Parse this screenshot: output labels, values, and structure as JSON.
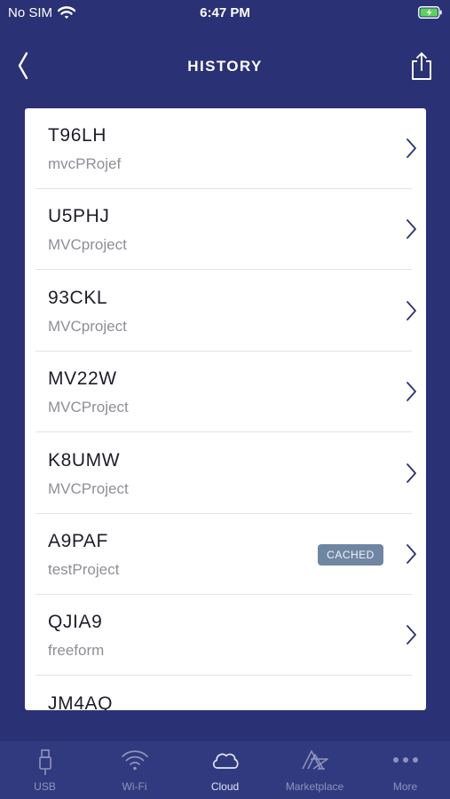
{
  "status_bar": {
    "carrier": "No SIM",
    "time": "6:47 PM"
  },
  "navbar": {
    "title": "HISTORY",
    "back_icon": "chevron-left-icon",
    "share_icon": "share-icon"
  },
  "history": {
    "items": [
      {
        "code": "T96LH",
        "project": "mvcPRojef",
        "badge": ""
      },
      {
        "code": "U5PHJ",
        "project": "MVCproject",
        "badge": ""
      },
      {
        "code": "93CKL",
        "project": "MVCproject",
        "badge": ""
      },
      {
        "code": "MV22W",
        "project": "MVCProject",
        "badge": ""
      },
      {
        "code": "K8UMW",
        "project": "MVCProject",
        "badge": ""
      },
      {
        "code": "A9PAF",
        "project": "testProject",
        "badge": "CACHED"
      },
      {
        "code": "QJIA9",
        "project": "freeform",
        "badge": ""
      },
      {
        "code": "JM4AQ",
        "project": "",
        "badge": ""
      }
    ]
  },
  "tabbar": {
    "tabs": [
      {
        "label": "USB",
        "icon": "usb-icon"
      },
      {
        "label": "Wi-Fi",
        "icon": "wifi-icon"
      },
      {
        "label": "Cloud",
        "icon": "cloud-icon"
      },
      {
        "label": "Marketplace",
        "icon": "marketplace-icon"
      },
      {
        "label": "More",
        "icon": "more-icon"
      }
    ],
    "active": "Cloud"
  },
  "colors": {
    "background": "#2a3175",
    "tabbar": "#323a7f",
    "badge": "#6f86a3",
    "chevron": "#2a3175",
    "battery_charge": "#5cd25a"
  }
}
